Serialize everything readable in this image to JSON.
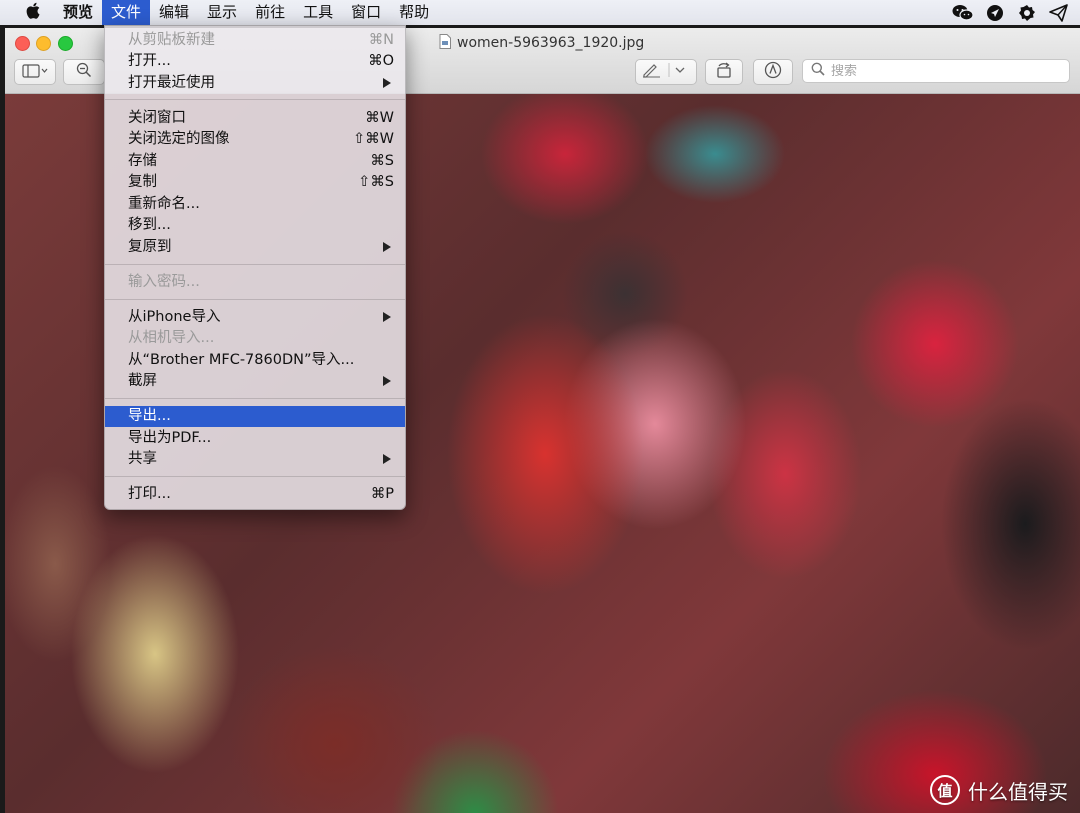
{
  "menubar": {
    "app_name": "预览",
    "items": [
      "文件",
      "编辑",
      "显示",
      "前往",
      "工具",
      "窗口",
      "帮助"
    ],
    "active_item": "文件"
  },
  "window": {
    "title": "women-5963963_1920.jpg",
    "search_placeholder": "搜索"
  },
  "file_menu": {
    "new_from_clipboard": {
      "label": "从剪贴板新建",
      "shortcut": "⌘N"
    },
    "open": {
      "label": "打开...",
      "shortcut": "⌘O"
    },
    "open_recent": {
      "label": "打开最近使用"
    },
    "close_window": {
      "label": "关闭窗口",
      "shortcut": "⌘W"
    },
    "close_selected": {
      "label": "关闭选定的图像",
      "shortcut": "⇧⌘W"
    },
    "save": {
      "label": "存储",
      "shortcut": "⌘S"
    },
    "duplicate": {
      "label": "复制",
      "shortcut": "⇧⌘S"
    },
    "rename": {
      "label": "重新命名..."
    },
    "move_to": {
      "label": "移到..."
    },
    "revert_to": {
      "label": "复原到"
    },
    "enter_password": {
      "label": "输入密码..."
    },
    "import_iphone": {
      "label": "从iPhone导入"
    },
    "import_camera": {
      "label": "从相机导入..."
    },
    "import_brother": {
      "label": "从“Brother MFC-7860DN”导入..."
    },
    "screenshot": {
      "label": "截屏"
    },
    "export": {
      "label": "导出..."
    },
    "export_pdf": {
      "label": "导出为PDF..."
    },
    "share": {
      "label": "共享"
    },
    "print": {
      "label": "打印...",
      "shortcut": "⌘P"
    }
  },
  "watermark": {
    "logo_text": "值",
    "text": "什么值得买"
  },
  "colors": {
    "menu_highlight": "#2c5ccf",
    "close": "#fc5f57",
    "minimize": "#fdbc2e",
    "maximize": "#28c840"
  }
}
